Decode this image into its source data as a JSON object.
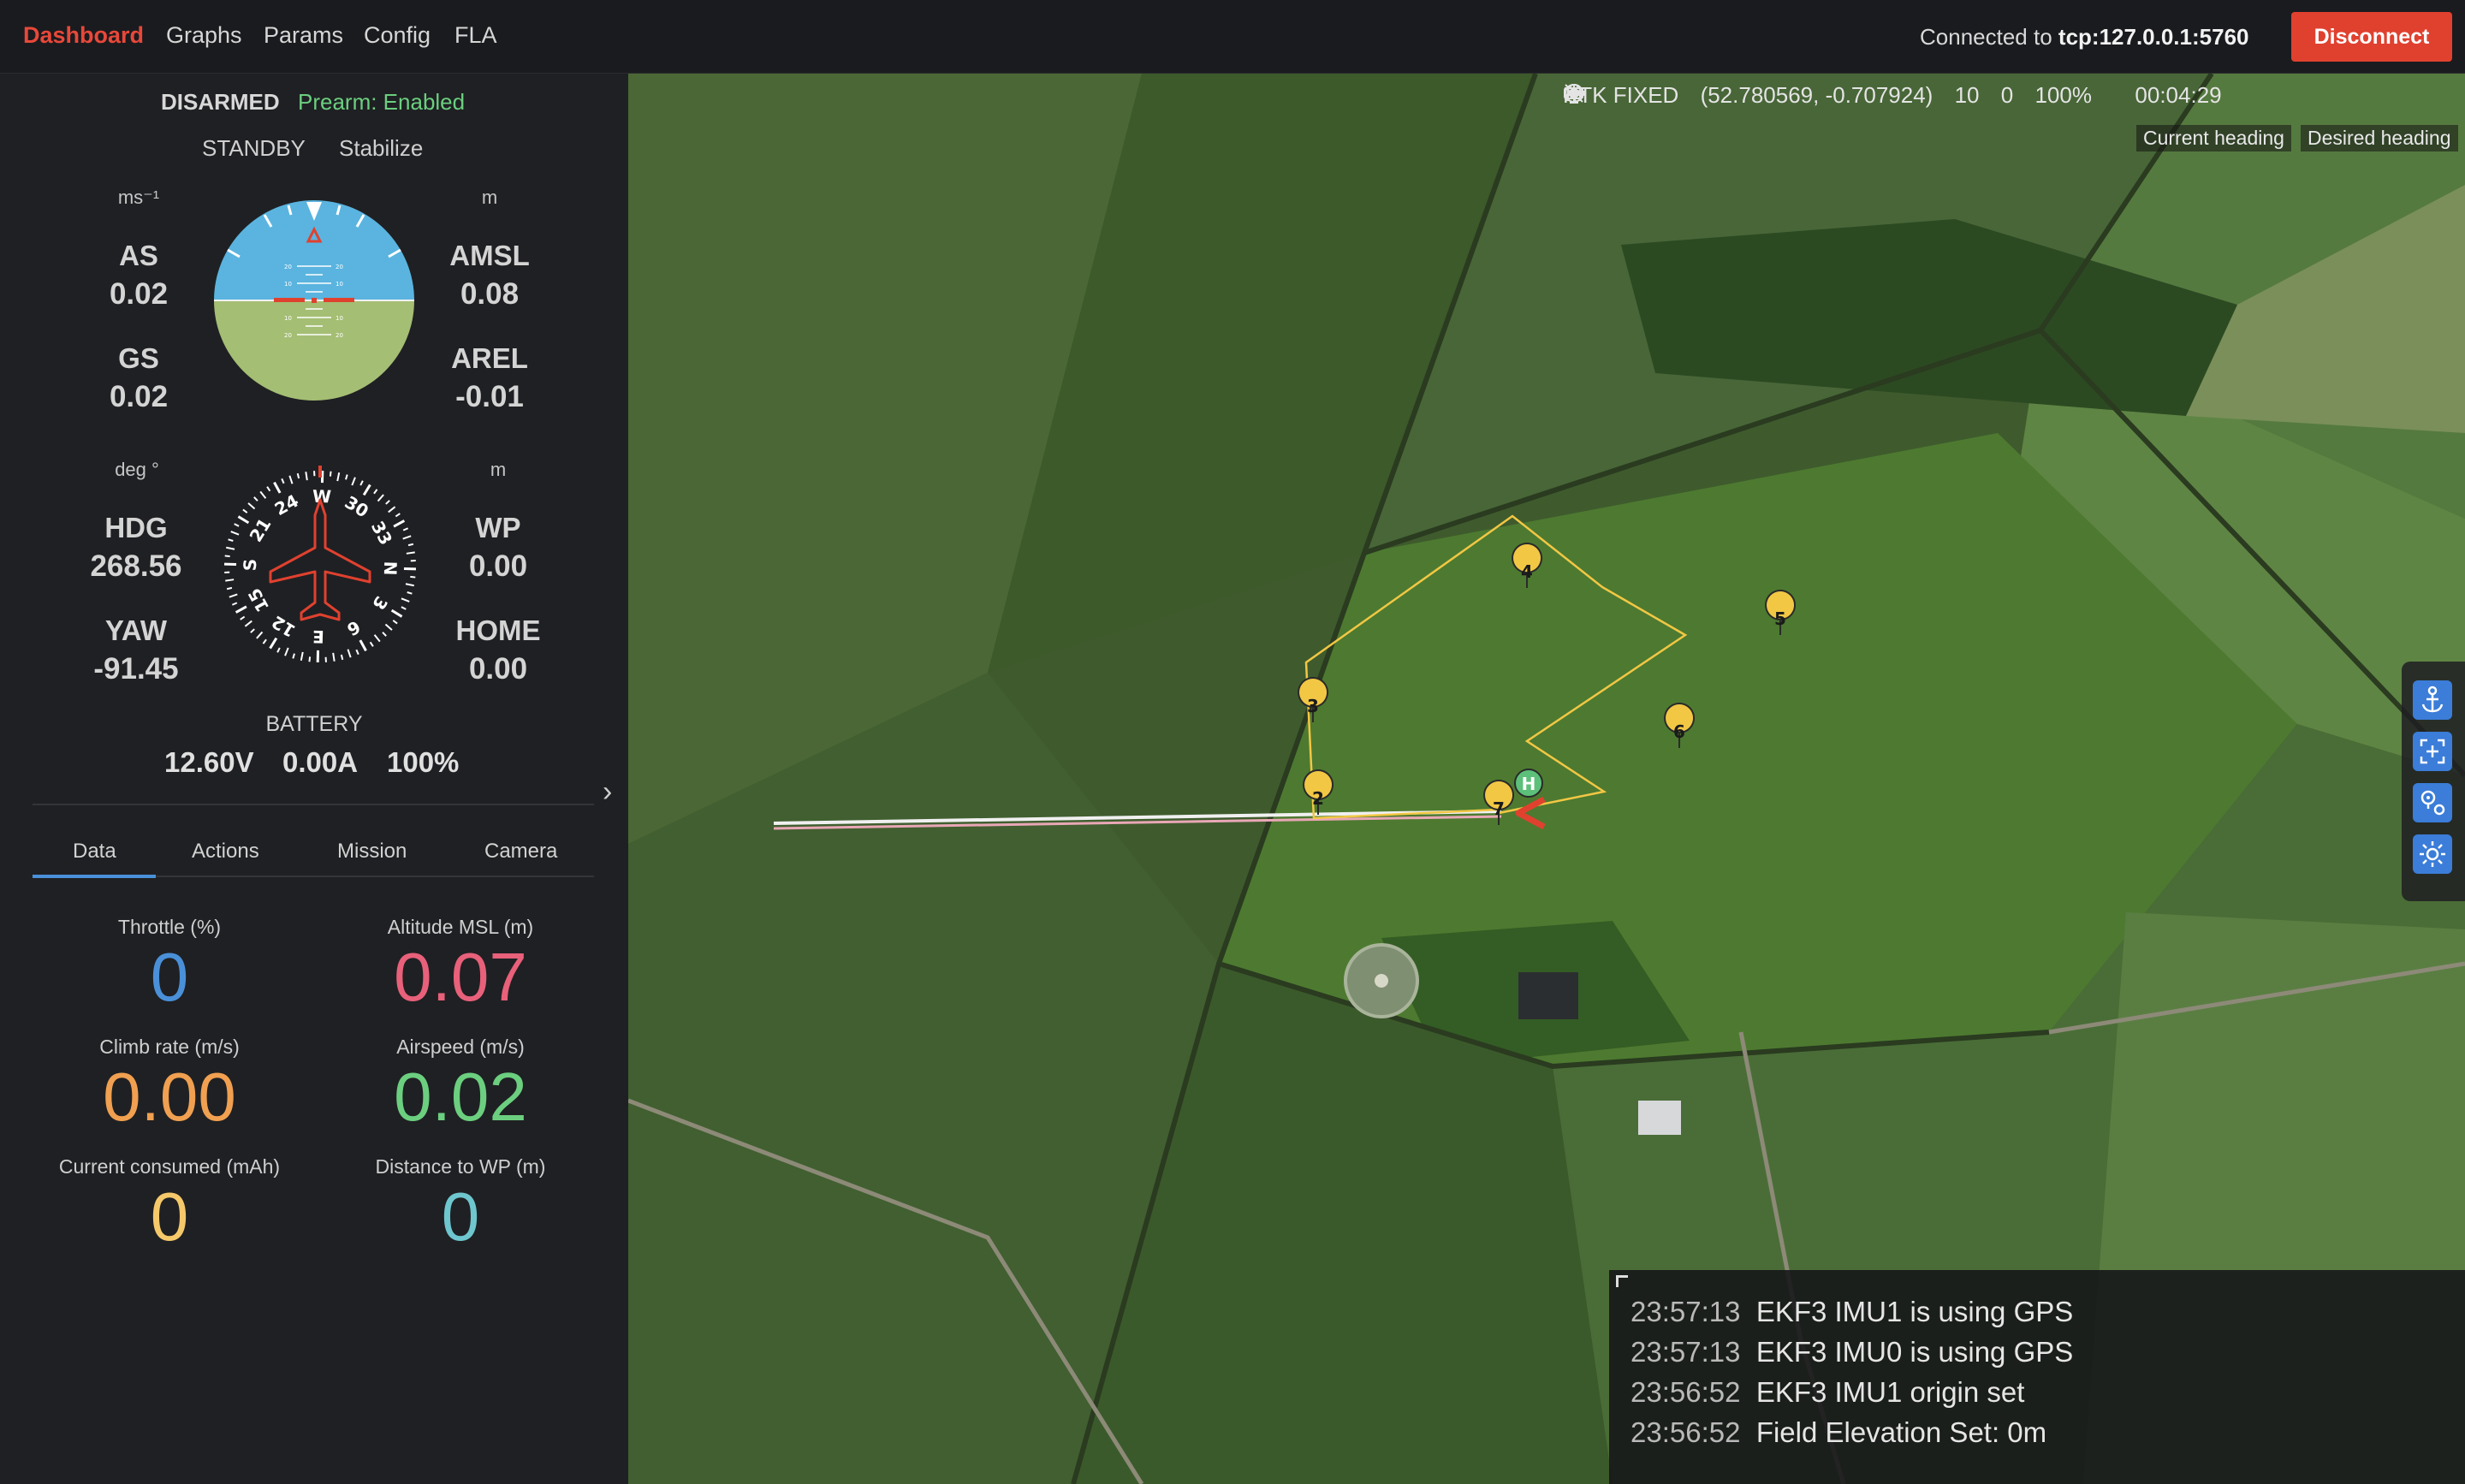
{
  "nav": {
    "items": [
      "Dashboard",
      "Graphs",
      "Params",
      "Config",
      "FLA"
    ],
    "active": "Dashboard",
    "connected_prefix": "Connected to",
    "connected_address": "tcp:127.0.0.1:5760",
    "disconnect_label": "Disconnect"
  },
  "colors": {
    "accent_red": "#e0412f",
    "throttle": "#4a90d9",
    "altitude": "#e8607a",
    "climb": "#f0a050",
    "airspeed": "#6bcf7f",
    "current": "#f5c86a",
    "distance": "#6ec6cf",
    "waypoint": "#f2c744",
    "home": "#5cc07a"
  },
  "state": {
    "arm": "DISARMED",
    "prearm": "Prearm: Enabled",
    "system": "STANDBY",
    "mode": "Stabilize"
  },
  "instruments": {
    "speed_unit": "ms⁻¹",
    "alt_unit": "m",
    "as_label": "AS",
    "as_value": "0.02",
    "gs_label": "GS",
    "gs_value": "0.02",
    "amsl_label": "AMSL",
    "amsl_value": "0.08",
    "arel_label": "AREL",
    "arel_value": "-0.01",
    "deg_unit": "deg °",
    "dist_unit": "m",
    "hdg_label": "HDG",
    "hdg_value": "268.56",
    "yaw_label": "YAW",
    "yaw_value": "-91.45",
    "wp_label": "WP",
    "wp_value": "0.00",
    "home_label": "HOME",
    "home_value": "0.00",
    "heading_deg": 268.56,
    "pitch_deg": 0,
    "roll_deg": 0
  },
  "battery": {
    "label": "BATTERY",
    "voltage": "12.60V",
    "current": "0.00A",
    "percent": "100%"
  },
  "tabs": [
    "Data",
    "Actions",
    "Mission",
    "Camera"
  ],
  "active_tab": "Data",
  "metrics": [
    {
      "label": "Throttle (%)",
      "value": "0"
    },
    {
      "label": "Altitude MSL (m)",
      "value": "0.07"
    },
    {
      "label": "Climb rate (m/s)",
      "value": "0.00"
    },
    {
      "label": "Airspeed (m/s)",
      "value": "0.02"
    },
    {
      "label": "Current consumed (mAh)",
      "value": "0"
    },
    {
      "label": "Distance to WP (m)",
      "value": "0"
    }
  ],
  "status": {
    "rtk": "RTK FIXED",
    "position": "(52.780569, -0.707924)",
    "satellites": "10",
    "signal": "0",
    "battery": "100%",
    "time": "00:04:29"
  },
  "heading_legend": {
    "current": "Current heading",
    "desired": "Desired heading"
  },
  "waypoints": [
    "2",
    "3",
    "4",
    "5",
    "6",
    "7"
  ],
  "home_marker": "H",
  "map_tools": [
    "anchor-icon",
    "center-map-icon",
    "waypoint-pin-icon",
    "drone-locate-icon"
  ],
  "console": [
    {
      "time": "23:57:13",
      "text": "EKF3 IMU1 is using GPS"
    },
    {
      "time": "23:57:13",
      "text": "EKF3 IMU0 is using GPS"
    },
    {
      "time": "23:56:52",
      "text": "EKF3 IMU1 origin set"
    },
    {
      "time": "23:56:52",
      "text": "Field Elevation Set: 0m"
    }
  ]
}
